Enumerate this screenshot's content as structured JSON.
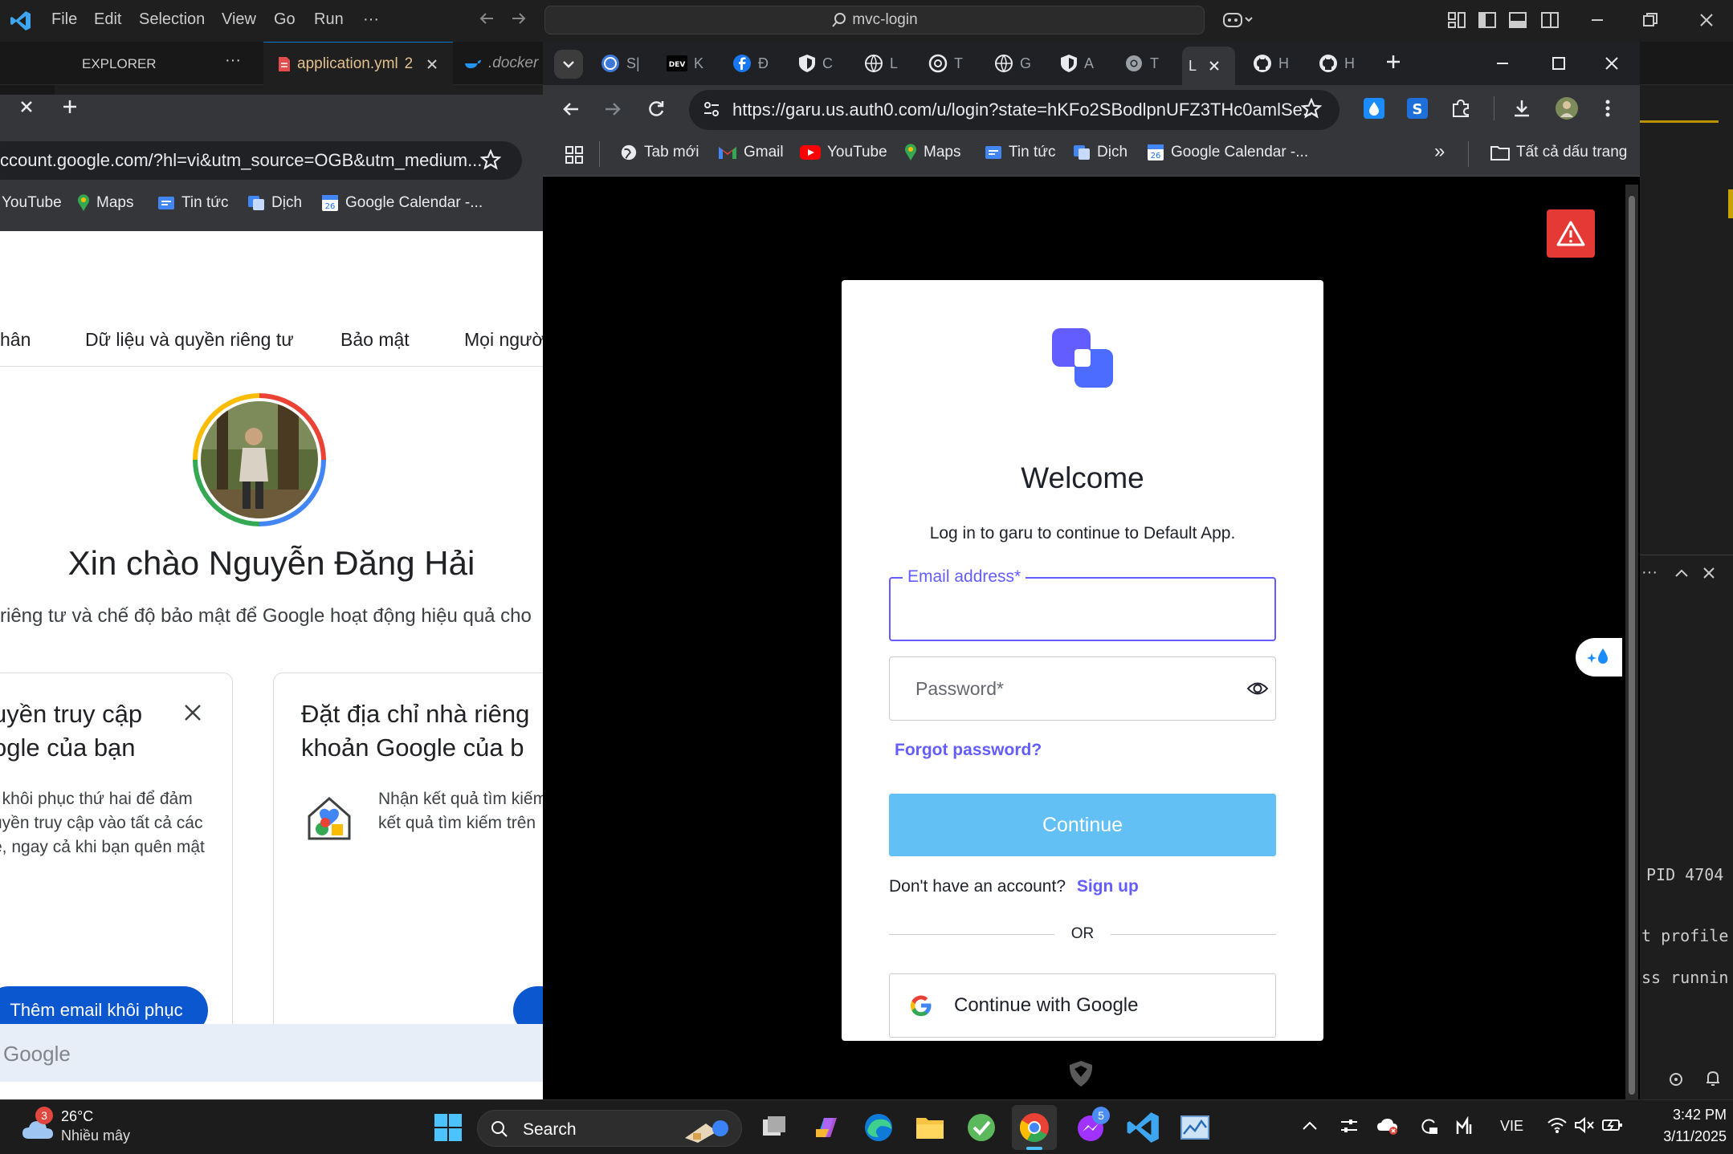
{
  "vscode": {
    "menu": [
      "File",
      "Edit",
      "Selection",
      "View",
      "Go",
      "Run",
      "···"
    ],
    "command_center": "mvc-login",
    "explorer_label": "EXPLORER",
    "explorer_more": "···",
    "tabs": [
      {
        "label": "application.yml",
        "badge": "2"
      },
      {
        "label": ".docker"
      }
    ],
    "terminal_lines": [
      "PID 4704",
      "t profile",
      "ss runnin"
    ],
    "panel_more": "···"
  },
  "chrome_left": {
    "url": "ccount.google.com/?hl=vi&utm_source=OGB&utm_medium...",
    "bookmarks": [
      "YouTube",
      "Maps",
      "Tin tức",
      "Dịch",
      "Google Calendar -..."
    ],
    "nav_tabs": [
      "hân",
      "Dữ liệu và quyền riêng tư",
      "Bảo mật",
      "Mọi người"
    ],
    "greeting": "Xin chào Nguyễn Đăng Hải",
    "subtitle": "riêng tư và chế độ bảo mật để Google hoạt động hiệu quả cho",
    "card1": {
      "title_line1": "uyền truy cập",
      "title_line2": "ogle của bạn",
      "body": [
        ". khôi phục thứ hai để đảm",
        "uyền truy cập vào tất cả các",
        "e, ngay cả khi bạn quên mật"
      ],
      "button": "Thêm email khôi phục"
    },
    "card2": {
      "title_line1": "Đặt địa chỉ nhà riêng",
      "title_line2": "khoản Google của b",
      "body": [
        "Nhận kết quả tìm kiếm",
        "kết quả tìm kiếm trên"
      ]
    },
    "footer": "Google"
  },
  "chrome_right": {
    "tabs": [
      "S|",
      "K",
      "Đ",
      "C",
      "L",
      "T",
      "G",
      "A",
      "T",
      "L",
      "H",
      "H"
    ],
    "url": "https://garu.us.auth0.com/u/login?state=hKFo2SBodlpnUFZ3THc0amlSe...",
    "bookmarks": [
      "Tab mới",
      "Gmail",
      "YouTube",
      "Maps",
      "Tin tức",
      "Dịch",
      "Google Calendar -..."
    ],
    "all_bookmarks": "Tất cả dấu trang",
    "overflow": "»"
  },
  "login": {
    "title": "Welcome",
    "subtitle": "Log in to garu to continue to Default App.",
    "email_label": "Email address*",
    "email_value": "",
    "password_placeholder": "Password*",
    "forgot": "Forgot password?",
    "continue": "Continue",
    "no_account": "Don't have an account?",
    "signup": "Sign up",
    "or": "OR",
    "google": "Continue with Google",
    "accent": "#635dff",
    "button_color": "#63c0f5"
  },
  "taskbar": {
    "weather_temp": "26°C",
    "weather_desc": "Nhiều mây",
    "weather_badge": "3",
    "search": "Search",
    "messenger_badge": "5",
    "lang": "VIE",
    "time": "3:42 PM",
    "date": "3/11/2025"
  }
}
